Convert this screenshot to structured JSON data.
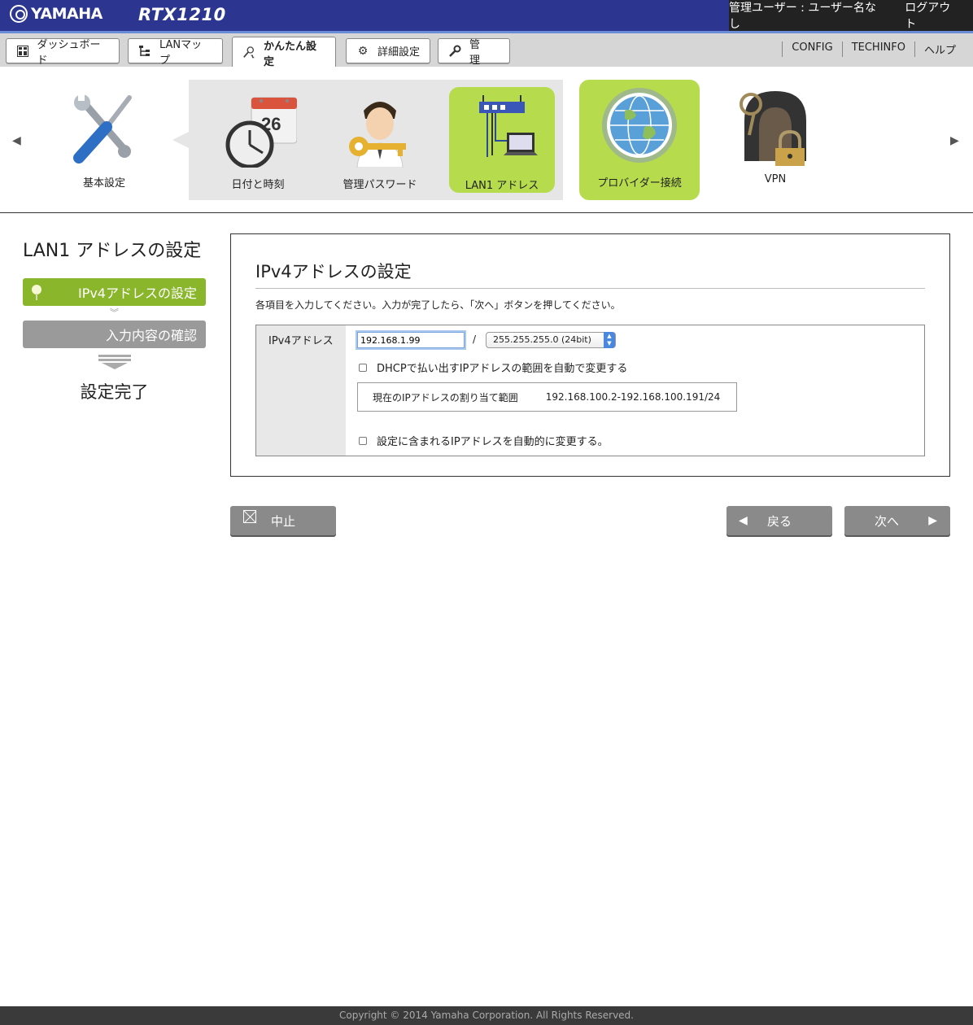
{
  "header": {
    "brand": "YAMAHA",
    "model": "RTX1210",
    "user_label": "管理ユーザー : ユーザー名なし",
    "logout": "ログアウト"
  },
  "nav": {
    "tabs": [
      {
        "label": "ダッシュボード",
        "icon": "dashboard-icon"
      },
      {
        "label": "LANマップ",
        "icon": "lan-map-icon"
      },
      {
        "label": "かんたん設定",
        "icon": "easy-setup-icon",
        "active": true
      },
      {
        "label": "詳細設定",
        "icon": "gear-icon"
      },
      {
        "label": "管　理",
        "icon": "wrench-icon"
      }
    ],
    "links": [
      "CONFIG",
      "TECHINFO",
      "ヘルプ"
    ]
  },
  "carousel": {
    "items": [
      {
        "label": "基本設定",
        "icon": "tools-icon"
      },
      {
        "label": "日付と時刻",
        "icon": "clock-calendar-icon",
        "calendar_day": "26"
      },
      {
        "label": "管理パスワード",
        "icon": "admin-key-icon"
      },
      {
        "label": "LAN1 アドレス",
        "icon": "router-pc-icon",
        "active": true
      },
      {
        "label": "プロバイダー接続",
        "icon": "globe-icon"
      },
      {
        "label": "VPN",
        "icon": "vpn-lock-icon"
      }
    ],
    "prev_arrow": "◀",
    "next_arrow": "▶"
  },
  "steps": {
    "title": "LAN1 アドレスの設定",
    "items": [
      {
        "label": "IPv4アドレスの設定",
        "state": "current"
      },
      {
        "label": "入力内容の確認",
        "state": "pending"
      }
    ],
    "done": "設定完了"
  },
  "panel": {
    "heading": "IPv4アドレスの設定",
    "instruction": "各項目を入力してください。入力が完了したら、「次へ」ボタンを押してください。",
    "field_label": "IPv4アドレス",
    "ip_value": "192.168.1.99",
    "slash": "/",
    "mask_value": "255.255.255.0 (24bit)",
    "dhcp_checkbox": "DHCPで払い出すIPアドレスの範囲を自動で変更する",
    "dhcp_checked": false,
    "range_label": "現在のIPアドレスの割り当て範囲",
    "range_value": "192.168.100.2-192.168.100.191/24",
    "auto_change_checkbox": "設定に含まれるIPアドレスを自動的に変更する。",
    "auto_change_checked": false
  },
  "buttons": {
    "cancel": "中止",
    "back": "戻る",
    "next": "次へ"
  },
  "footer": {
    "copyright": "Copyright © 2014 Yamaha Corporation. All Rights Reserved."
  },
  "colors": {
    "header_bg": "#2c3590",
    "accent_green": "#b6dc4d",
    "step_green": "#8ab62c",
    "button_gray": "#8a8a8a"
  }
}
